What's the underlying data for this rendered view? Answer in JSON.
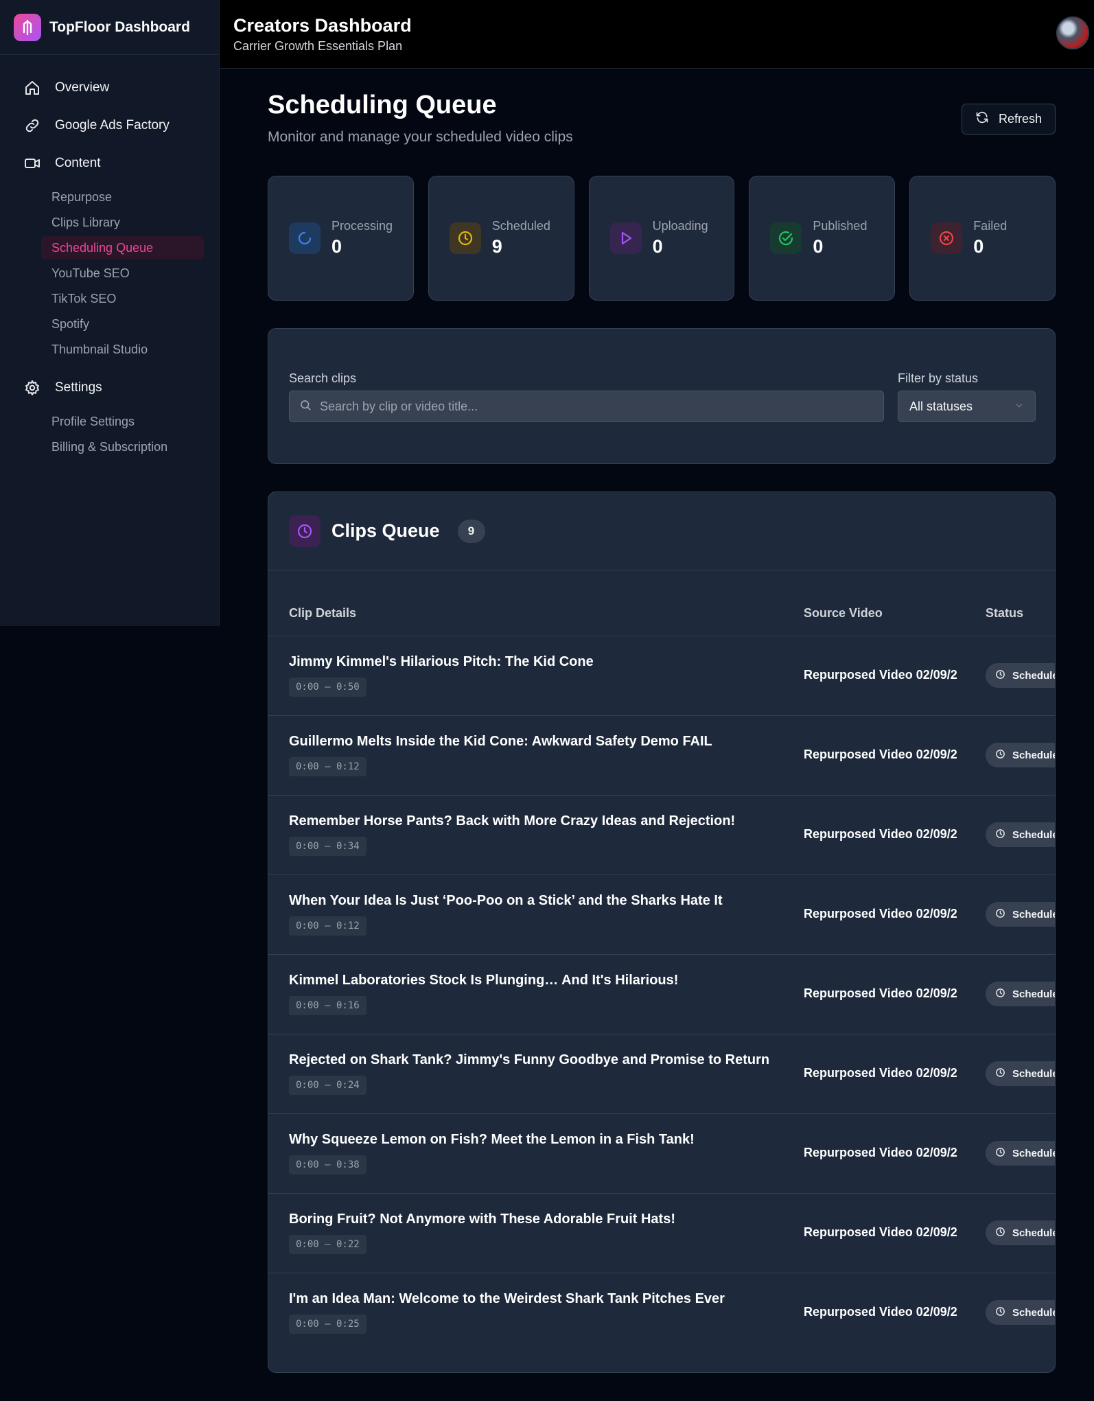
{
  "brand": {
    "name": "TopFloor Dashboard"
  },
  "header": {
    "title": "Creators Dashboard",
    "subtitle": "Carrier Growth Essentials Plan"
  },
  "sidebar": {
    "nav": [
      {
        "label": "Overview",
        "icon": "home-icon"
      },
      {
        "label": "Google Ads Factory",
        "icon": "link-icon"
      },
      {
        "label": "Content",
        "icon": "video-icon"
      }
    ],
    "content_items": [
      {
        "label": "Repurpose",
        "active": false
      },
      {
        "label": "Clips Library",
        "active": false
      },
      {
        "label": "Scheduling Queue",
        "active": true
      },
      {
        "label": "YouTube SEO",
        "active": false
      },
      {
        "label": "TikTok SEO",
        "active": false
      },
      {
        "label": "Spotify",
        "active": false
      },
      {
        "label": "Thumbnail Studio",
        "active": false
      }
    ],
    "settings": {
      "label": "Settings",
      "icon": "gear-icon"
    },
    "settings_items": [
      {
        "label": "Profile Settings"
      },
      {
        "label": "Billing & Subscription"
      }
    ]
  },
  "page": {
    "title": "Scheduling Queue",
    "subtitle": "Monitor and manage your scheduled video clips",
    "refresh_label": "Refresh"
  },
  "stats": [
    {
      "label": "Processing",
      "value": "0",
      "icon": "spinner-icon",
      "color": "#3b82f6"
    },
    {
      "label": "Scheduled",
      "value": "9",
      "icon": "clock-icon",
      "color": "#eab308"
    },
    {
      "label": "Uploading",
      "value": "0",
      "icon": "play-icon",
      "color": "#a855f7"
    },
    {
      "label": "Published",
      "value": "0",
      "icon": "check-circle-icon",
      "color": "#22c55e"
    },
    {
      "label": "Failed",
      "value": "0",
      "icon": "x-circle-icon",
      "color": "#ef4444"
    }
  ],
  "filters": {
    "search_label": "Search clips",
    "search_placeholder": "Search by clip or video title...",
    "status_label": "Filter by status",
    "status_selected": "All statuses"
  },
  "queue": {
    "title": "Clips Queue",
    "count": "9",
    "columns": {
      "clip": "Clip Details",
      "source": "Source Video",
      "status": "Status"
    },
    "rows": [
      {
        "title": "Jimmy Kimmel's Hilarious Pitch: The Kid Cone",
        "time": "0:00 – 0:50",
        "source": "Repurposed Video 02/09/2",
        "status": "Scheduled"
      },
      {
        "title": "Guillermo Melts Inside the Kid Cone: Awkward Safety Demo FAIL",
        "time": "0:00 – 0:12",
        "source": "Repurposed Video 02/09/2",
        "status": "Scheduled"
      },
      {
        "title": "Remember Horse Pants? Back with More Crazy Ideas and Rejection!",
        "time": "0:00 – 0:34",
        "source": "Repurposed Video 02/09/2",
        "status": "Scheduled"
      },
      {
        "title": "When Your Idea Is Just ‘Poo-Poo on a Stick’ and the Sharks Hate It",
        "time": "0:00 – 0:12",
        "source": "Repurposed Video 02/09/2",
        "status": "Scheduled"
      },
      {
        "title": "Kimmel Laboratories Stock Is Plunging… And It's Hilarious!",
        "time": "0:00 – 0:16",
        "source": "Repurposed Video 02/09/2",
        "status": "Scheduled"
      },
      {
        "title": "Rejected on Shark Tank? Jimmy's Funny Goodbye and Promise to Return",
        "time": "0:00 – 0:24",
        "source": "Repurposed Video 02/09/2",
        "status": "Scheduled"
      },
      {
        "title": "Why Squeeze Lemon on Fish? Meet the Lemon in a Fish Tank!",
        "time": "0:00 – 0:38",
        "source": "Repurposed Video 02/09/2",
        "status": "Scheduled"
      },
      {
        "title": "Boring Fruit? Not Anymore with These Adorable Fruit Hats!",
        "time": "0:00 – 0:22",
        "source": "Repurposed Video 02/09/2",
        "status": "Scheduled"
      },
      {
        "title": "I'm an Idea Man: Welcome to the Weirdest Shark Tank Pitches Ever",
        "time": "0:00 – 0:25",
        "source": "Repurposed Video 02/09/2",
        "status": "Scheduled"
      }
    ]
  },
  "colors": {
    "accent": "#ec4899",
    "background": "#030712",
    "card": "#1e293b"
  }
}
